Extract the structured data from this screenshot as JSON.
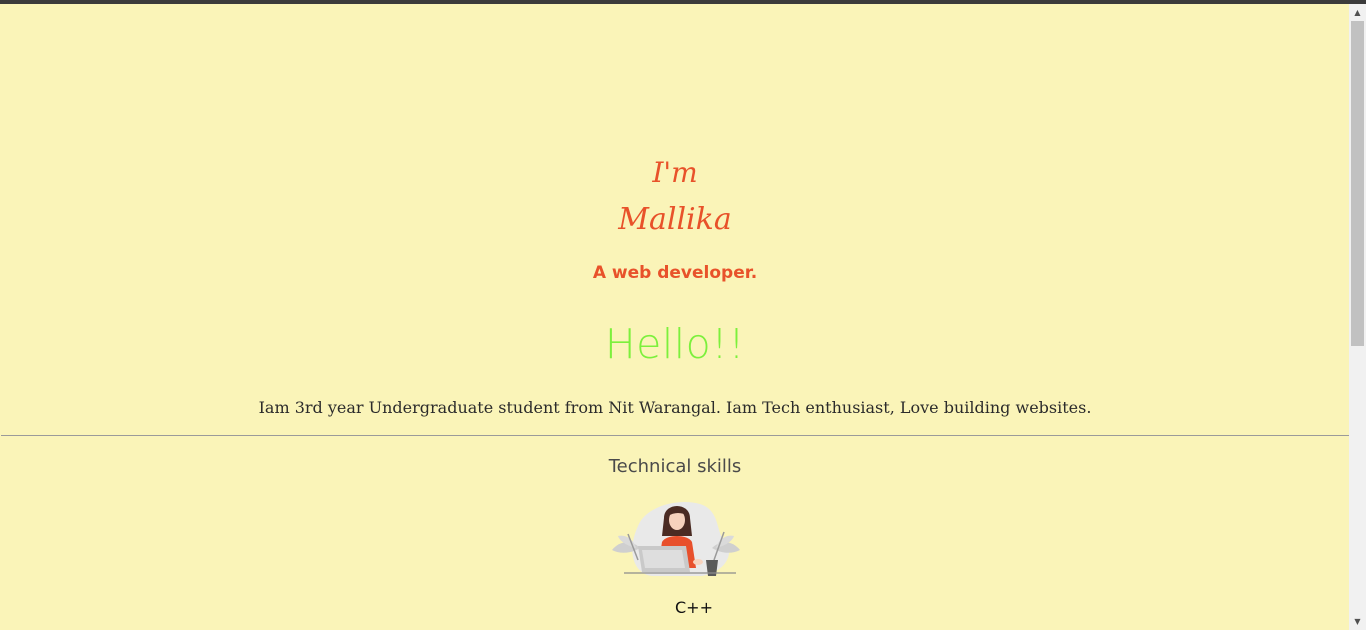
{
  "intro": {
    "im": "I'm",
    "name": "Mallika",
    "role": "A web developer."
  },
  "greeting": "Hello!!",
  "bio": "Iam 3rd year Undergraduate student from Nit Warangal. Iam Tech enthusiast, Love building websites.",
  "skills": {
    "title": "Technical skills",
    "items": [
      {
        "label": "C++",
        "icon": "woman-with-laptop-illustration"
      }
    ]
  },
  "colors": {
    "background": "#faf4b8",
    "accent": "#e8522a",
    "greeting": "#7cf03c"
  }
}
